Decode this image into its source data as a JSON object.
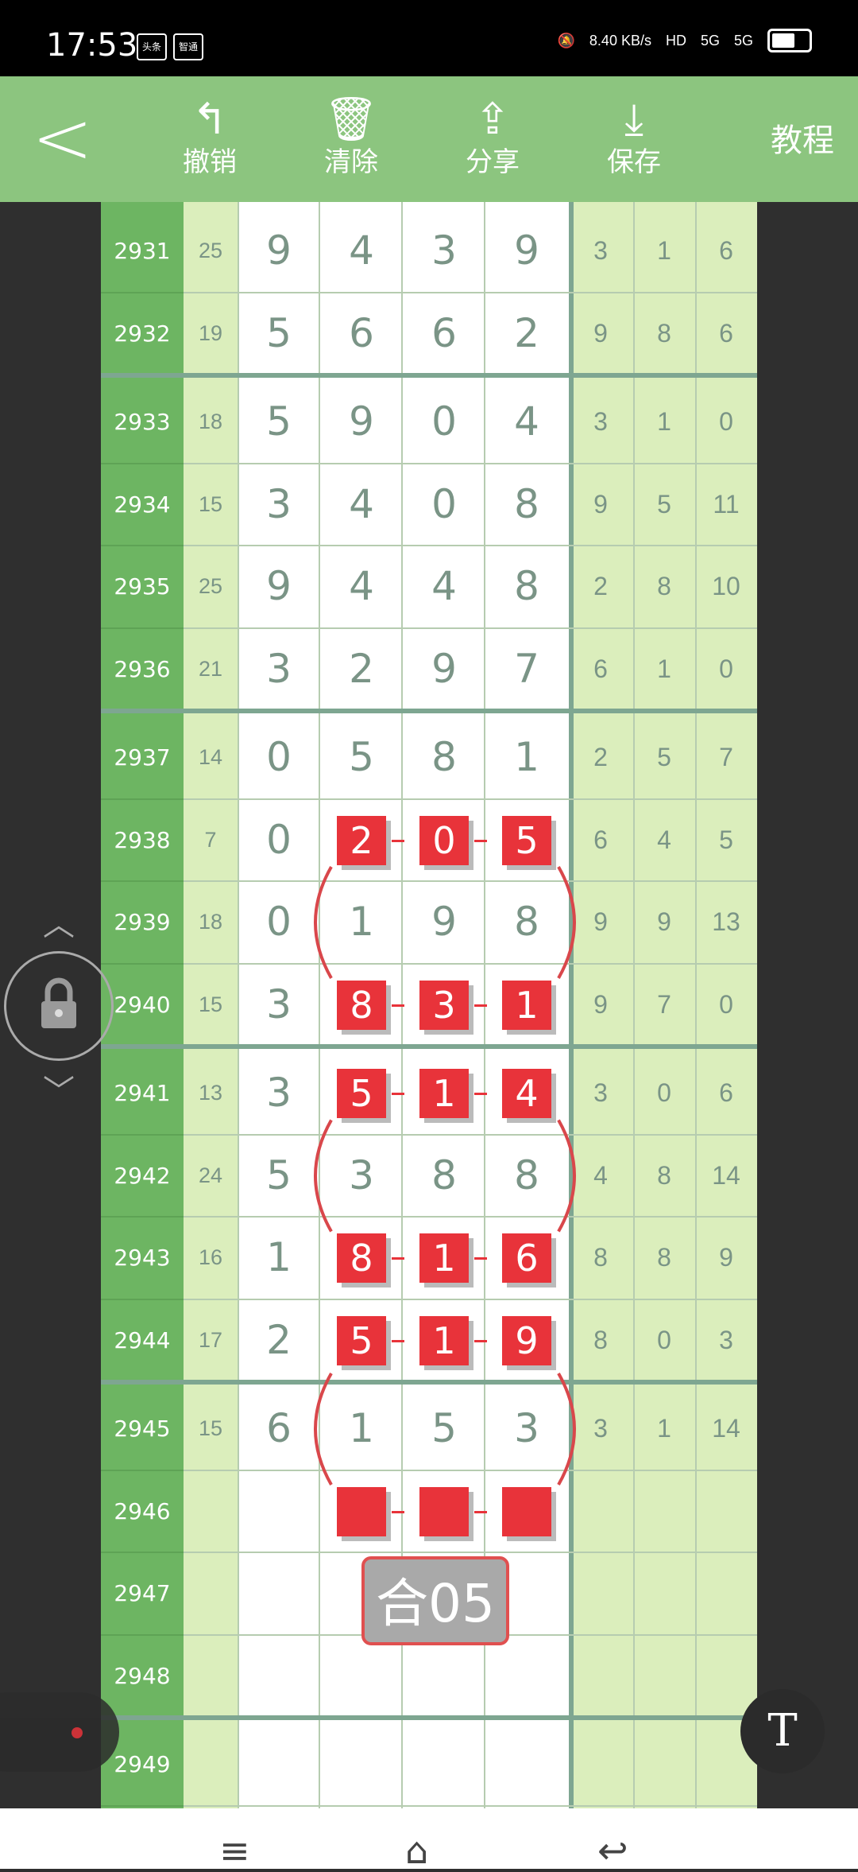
{
  "status": {
    "time": "17:53",
    "app1": "头条",
    "app2": "智通",
    "speed": "8.40 KB/s",
    "hd": "HD",
    "net1": "5G",
    "net2": "5G"
  },
  "toolbar": {
    "back": "<",
    "undo": "撤销",
    "clear": "清除",
    "share": "分享",
    "save": "保存",
    "tutorial": "教程"
  },
  "rows": [
    {
      "id": "2931",
      "sum": "25",
      "d": [
        "9",
        "4",
        "3",
        "9"
      ],
      "r": [
        "3",
        "1",
        "6"
      ]
    },
    {
      "id": "2932",
      "sum": "19",
      "d": [
        "5",
        "6",
        "6",
        "2"
      ],
      "r": [
        "9",
        "8",
        "6"
      ]
    },
    {
      "id": "2933",
      "sum": "18",
      "d": [
        "5",
        "9",
        "0",
        "4"
      ],
      "r": [
        "3",
        "1",
        "0"
      ]
    },
    {
      "id": "2934",
      "sum": "15",
      "d": [
        "3",
        "4",
        "0",
        "8"
      ],
      "r": [
        "9",
        "5",
        "11"
      ]
    },
    {
      "id": "2935",
      "sum": "25",
      "d": [
        "9",
        "4",
        "4",
        "8"
      ],
      "r": [
        "2",
        "8",
        "10"
      ]
    },
    {
      "id": "2936",
      "sum": "21",
      "d": [
        "3",
        "2",
        "9",
        "7"
      ],
      "r": [
        "6",
        "1",
        "0"
      ]
    },
    {
      "id": "2937",
      "sum": "14",
      "d": [
        "0",
        "5",
        "8",
        "1"
      ],
      "r": [
        "2",
        "5",
        "7"
      ]
    },
    {
      "id": "2938",
      "sum": "7",
      "d": [
        "0",
        "2",
        "0",
        "5"
      ],
      "r": [
        "6",
        "4",
        "5"
      ]
    },
    {
      "id": "2939",
      "sum": "18",
      "d": [
        "0",
        "1",
        "9",
        "8"
      ],
      "r": [
        "9",
        "9",
        "13"
      ]
    },
    {
      "id": "2940",
      "sum": "15",
      "d": [
        "3",
        "8",
        "3",
        "1"
      ],
      "r": [
        "9",
        "7",
        "0"
      ]
    },
    {
      "id": "2941",
      "sum": "13",
      "d": [
        "3",
        "5",
        "1",
        "4"
      ],
      "r": [
        "3",
        "0",
        "6"
      ]
    },
    {
      "id": "2942",
      "sum": "24",
      "d": [
        "5",
        "3",
        "8",
        "8"
      ],
      "r": [
        "4",
        "8",
        "14"
      ]
    },
    {
      "id": "2943",
      "sum": "16",
      "d": [
        "1",
        "8",
        "1",
        "6"
      ],
      "r": [
        "8",
        "8",
        "9"
      ]
    },
    {
      "id": "2944",
      "sum": "17",
      "d": [
        "2",
        "5",
        "1",
        "9"
      ],
      "r": [
        "8",
        "0",
        "3"
      ]
    },
    {
      "id": "2945",
      "sum": "15",
      "d": [
        "6",
        "1",
        "5",
        "3"
      ],
      "r": [
        "3",
        "1",
        "14"
      ]
    },
    {
      "id": "2946",
      "sum": "",
      "d": [
        "",
        "",
        "",
        ""
      ],
      "r": [
        "",
        "",
        ""
      ]
    },
    {
      "id": "2947",
      "sum": "",
      "d": [
        "",
        "",
        "",
        ""
      ],
      "r": [
        "",
        "",
        ""
      ]
    },
    {
      "id": "2948",
      "sum": "",
      "d": [
        "",
        "",
        "",
        ""
      ],
      "r": [
        "",
        "",
        ""
      ]
    },
    {
      "id": "2949",
      "sum": "",
      "d": [
        "",
        "",
        "",
        ""
      ],
      "r": [
        "",
        "",
        ""
      ]
    }
  ],
  "highlight_label": "合05",
  "t_button": "T",
  "icons": {
    "undo": "undo-arrow",
    "clear": "trash",
    "share": "share",
    "save": "download",
    "lock": "lock",
    "menu": "menu",
    "home": "home",
    "back": "back"
  }
}
